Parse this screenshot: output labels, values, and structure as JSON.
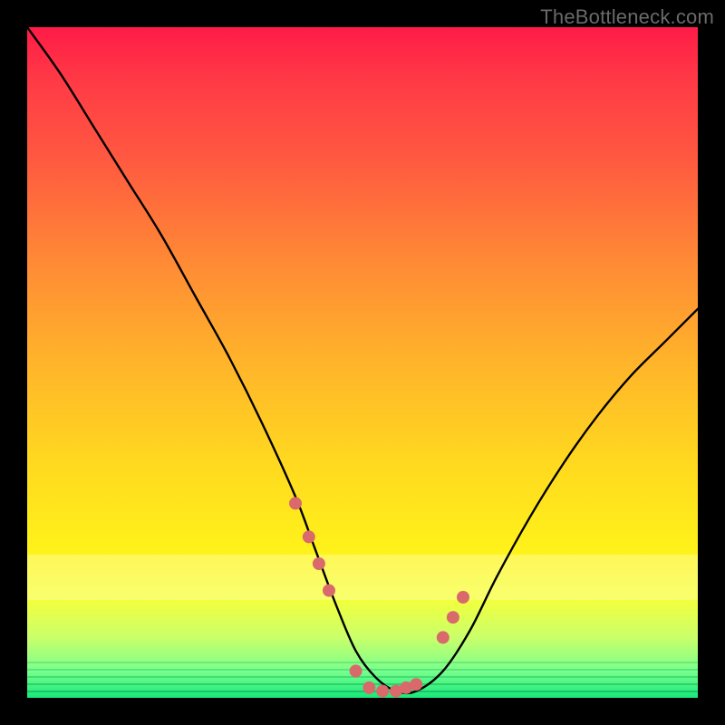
{
  "watermark": "TheBottleneck.com",
  "chart_data": {
    "type": "line",
    "title": "",
    "xlabel": "",
    "ylabel": "",
    "xlim": [
      0,
      100
    ],
    "ylim": [
      0,
      100
    ],
    "series": [
      {
        "name": "bottleneck-curve",
        "x": [
          0,
          5,
          10,
          15,
          20,
          25,
          30,
          35,
          40,
          43,
          46,
          49,
          52,
          55,
          58,
          62,
          66,
          70,
          75,
          80,
          85,
          90,
          95,
          100
        ],
        "y": [
          100,
          93,
          85,
          77,
          69,
          60,
          51,
          41,
          30,
          22,
          14,
          7,
          3,
          1,
          1,
          4,
          10,
          18,
          27,
          35,
          42,
          48,
          53,
          58
        ]
      }
    ],
    "markers": {
      "name": "highlight-points",
      "color": "#d9696b",
      "radius_px": 7,
      "x": [
        40,
        42,
        43.5,
        45,
        49,
        51,
        53,
        55,
        56.5,
        58,
        62,
        63.5,
        65
      ],
      "y": [
        29,
        24,
        20,
        16,
        4,
        1.5,
        1,
        1,
        1.5,
        2,
        9,
        12,
        15
      ]
    },
    "gradient_bands": [
      {
        "y_from": 100,
        "y_to": 22,
        "note": "red-orange-yellow gradient"
      },
      {
        "y_from": 22,
        "y_to": 15,
        "note": "pale yellow plateau"
      },
      {
        "y_from": 15,
        "y_to": 0,
        "note": "green base with fine stripes"
      }
    ]
  }
}
